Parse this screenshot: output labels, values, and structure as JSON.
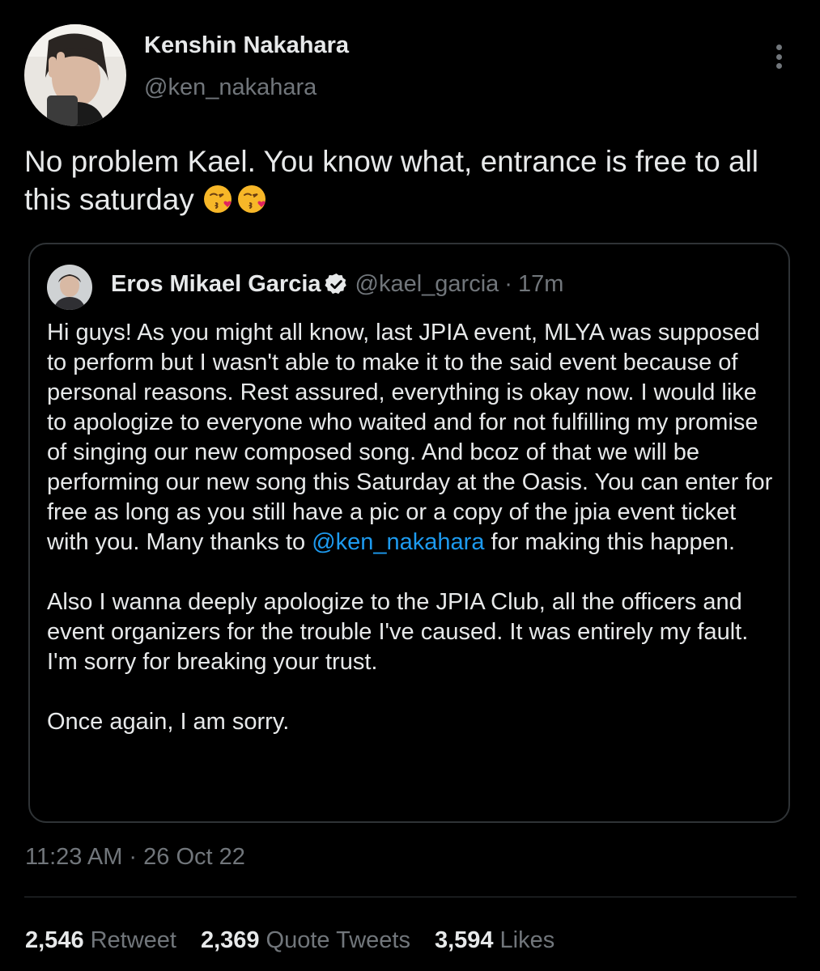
{
  "tweet": {
    "author": {
      "name": "Kenshin Nakahara",
      "handle": "@ken_nakahara"
    },
    "text": "No problem Kael. You know what, entrance is free to all this saturday",
    "emojis": [
      "kissing-face-heart-emoji",
      "kissing-face-heart-emoji"
    ],
    "timestamp": "11:23 AM · 26 Oct 22"
  },
  "quote": {
    "author": {
      "name": "Eros Mikael Garcia",
      "verified": true,
      "handle": "@kael_garcia",
      "separator": "·",
      "time": "17m"
    },
    "body": {
      "p1_before_mention": "Hi guys! As you might all know, last JPIA event, MLYA was supposed to perform but I wasn't able to make it to the said event because of personal reasons. Rest assured, everything is okay now. I would like to apologize to everyone who waited and for not fulfilling my promise of singing our new composed song. And bcoz of that we will be performing our new song this Saturday at the Oasis. You can enter for free as long as you still have a pic or a copy of the jpia event ticket with you. Many thanks to ",
      "mention": "@ken_nakahara",
      "p1_after_mention": " for making this happen.",
      "p2": "Also I wanna deeply apologize to the JPIA Club, all the officers and event organizers for the trouble I've caused. It was entirely my fault. I'm sorry for breaking your trust.",
      "p3": "Once again, I am sorry."
    }
  },
  "stats": {
    "retweets": {
      "count": "2,546",
      "label": "Retweet"
    },
    "quotes": {
      "count": "2,369",
      "label": "Quote Tweets"
    },
    "likes": {
      "count": "3,594",
      "label": "Likes"
    }
  },
  "colors": {
    "background": "#000000",
    "text_primary": "#e7e9ea",
    "text_secondary": "#71767b",
    "link": "#1d9bf0",
    "border": "#2f3336",
    "emoji_yellow": "#f7b728",
    "emoji_heart": "#e0245e"
  }
}
